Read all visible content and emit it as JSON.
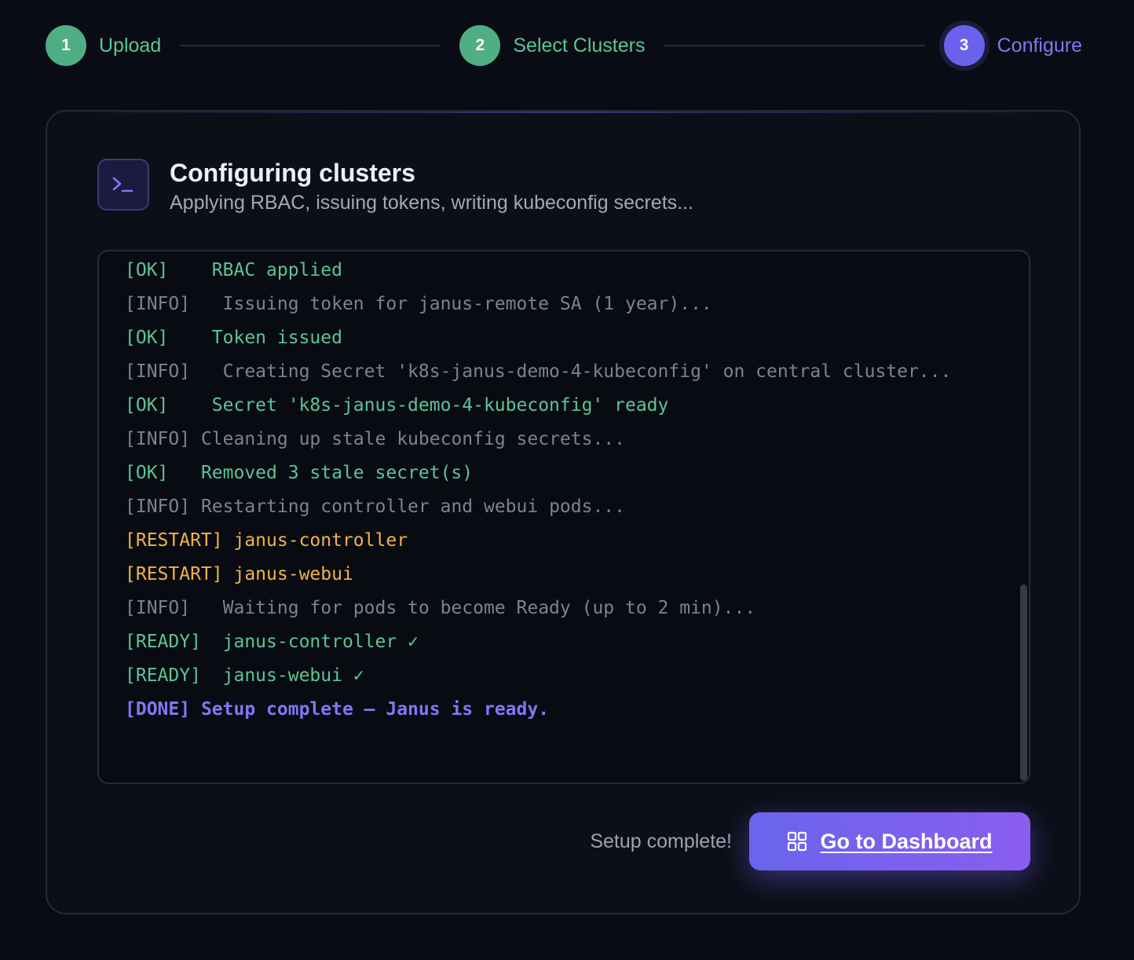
{
  "stepper": {
    "steps": [
      {
        "number": "1",
        "label": "Upload",
        "state": "done"
      },
      {
        "number": "2",
        "label": "Select Clusters",
        "state": "done"
      },
      {
        "number": "3",
        "label": "Configure",
        "state": "active"
      }
    ]
  },
  "card": {
    "icon": "terminal-icon",
    "title": "Configuring clusters",
    "subtitle": "Applying RBAC, issuing tokens, writing kubeconfig secrets..."
  },
  "log": {
    "lines": [
      {
        "tag": "[OK]",
        "text": "RBAC applied",
        "gap": "    ",
        "level": "ok"
      },
      {
        "tag": "[INFO]",
        "text": "Issuing token for janus-remote SA (1 year)...",
        "gap": "   ",
        "level": "info"
      },
      {
        "tag": "[OK]",
        "text": "Token issued",
        "gap": "    ",
        "level": "ok"
      },
      {
        "tag": "[INFO]",
        "text": "Creating Secret 'k8s-janus-demo-4-kubeconfig' on central cluster...",
        "gap": "   ",
        "level": "info"
      },
      {
        "tag": "[OK]",
        "text": "Secret 'k8s-janus-demo-4-kubeconfig' ready",
        "gap": "    ",
        "level": "ok"
      },
      {
        "tag": "[INFO]",
        "text": "Cleaning up stale kubeconfig secrets...",
        "gap": " ",
        "level": "info"
      },
      {
        "tag": "[OK]",
        "text": "Removed 3 stale secret(s)",
        "gap": "   ",
        "level": "ok"
      },
      {
        "tag": "[INFO]",
        "text": "Restarting controller and webui pods...",
        "gap": " ",
        "level": "info"
      },
      {
        "tag": "[RESTART]",
        "text": "janus-controller",
        "gap": " ",
        "level": "restart"
      },
      {
        "tag": "[RESTART]",
        "text": "janus-webui",
        "gap": " ",
        "level": "restart"
      },
      {
        "tag": "[INFO]",
        "text": "Waiting for pods to become Ready (up to 2 min)...",
        "gap": "   ",
        "level": "info"
      },
      {
        "tag": "[READY]",
        "text": "janus-controller ✓",
        "gap": "  ",
        "level": "ready"
      },
      {
        "tag": "[READY]",
        "text": "janus-webui ✓",
        "gap": "  ",
        "level": "ready"
      },
      {
        "tag": "[DONE]",
        "text": "Setup complete — Janus is ready.",
        "gap": " ",
        "level": "done"
      }
    ]
  },
  "footer": {
    "status": "Setup complete!",
    "button_label": "Go to Dashboard",
    "button_icon": "dashboard-icon"
  },
  "colors": {
    "success": "#5cc595",
    "accent": "#6a62ec",
    "info": "#7c8293",
    "restart": "#f0b34a"
  }
}
